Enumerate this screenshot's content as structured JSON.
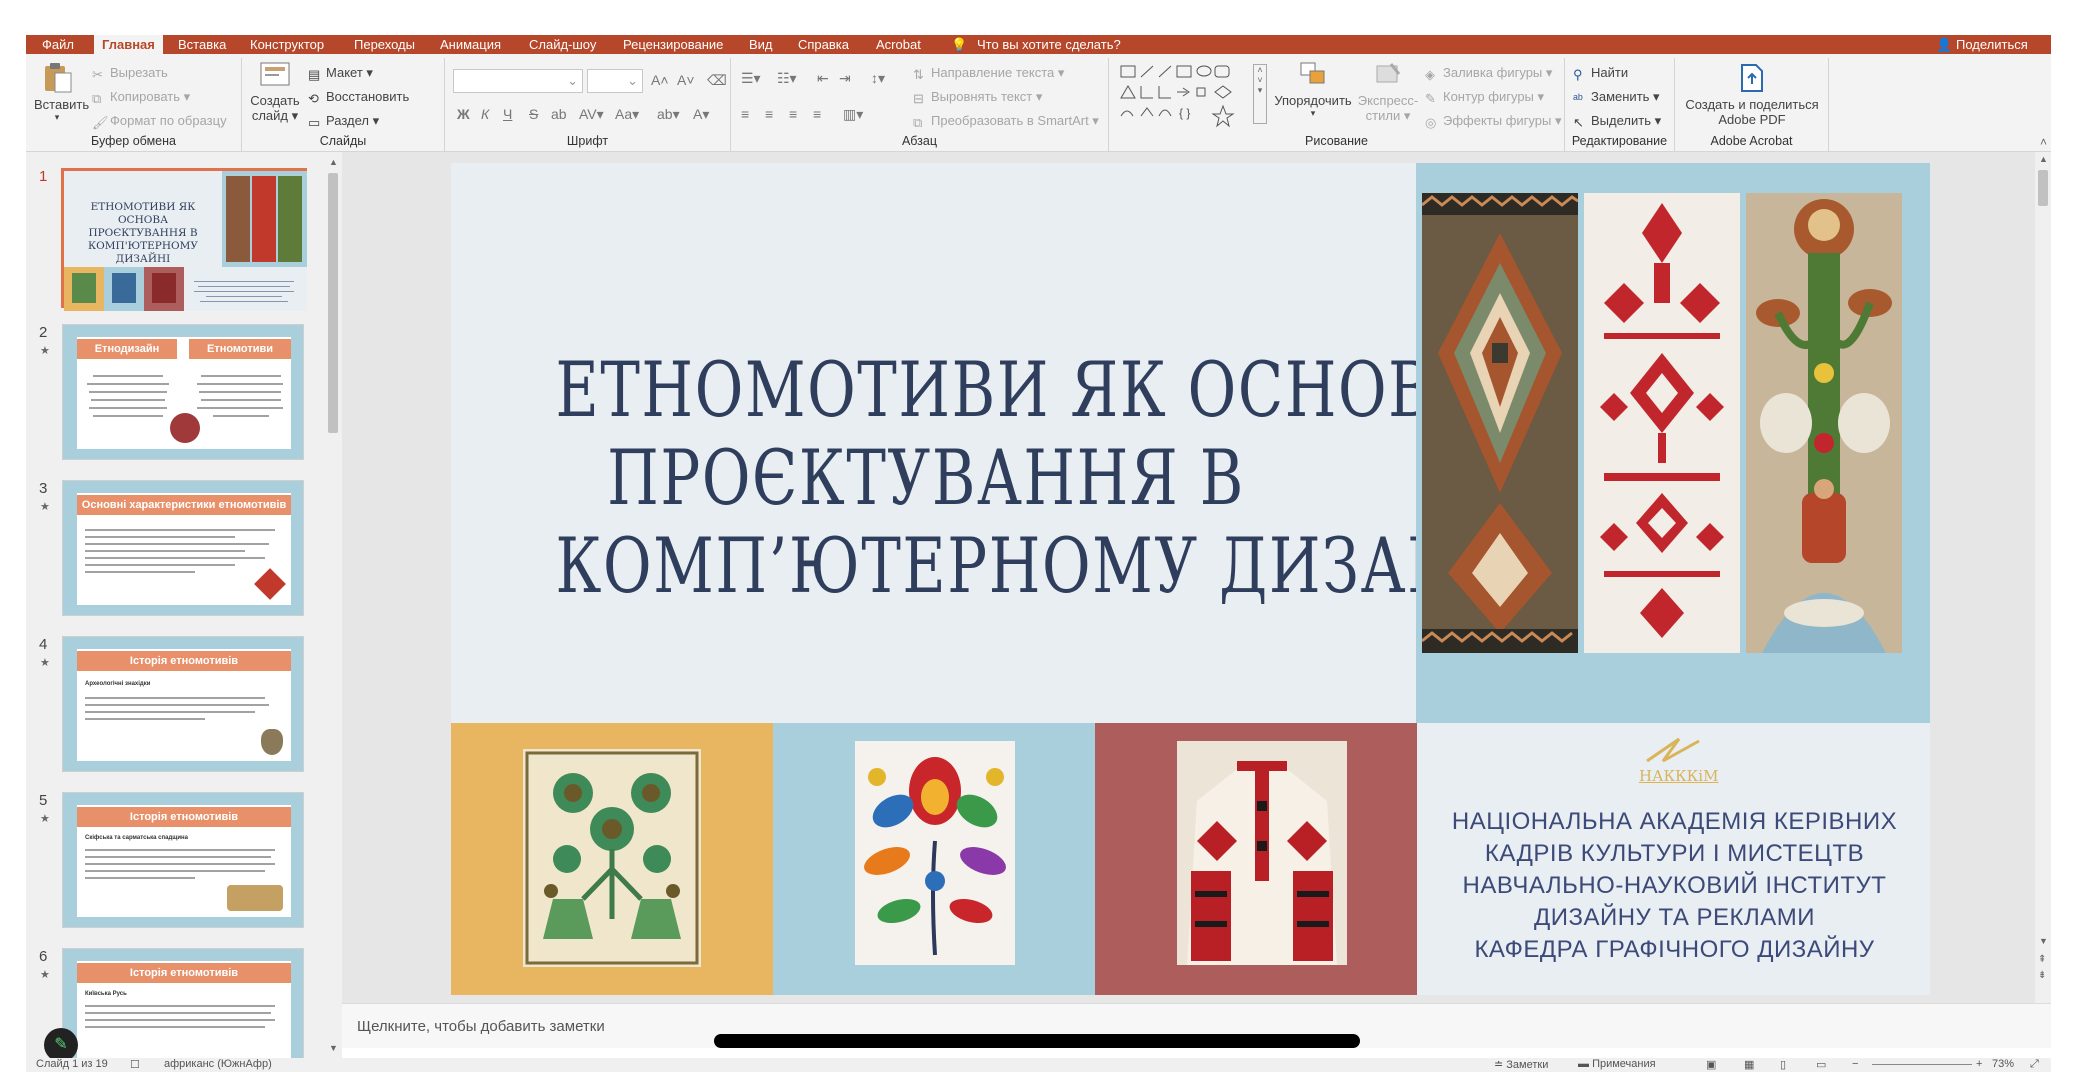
{
  "ribbon_tabs": {
    "file": "Файл",
    "home": "Главная",
    "insert": "Вставка",
    "design": "Конструктор",
    "transitions": "Переходы",
    "animations": "Анимация",
    "slideshow": "Слайд-шоу",
    "review": "Рецензирование",
    "view": "Вид",
    "help": "Справка",
    "acrobat": "Acrobat",
    "tell_me": "Что вы хотите сделать?",
    "share": "Поделиться"
  },
  "clipboard": {
    "paste": "Вставить",
    "cut": "Вырезать",
    "copy": "Копировать",
    "format_painter": "Формат по образцу",
    "label": "Буфер обмена"
  },
  "slides_group": {
    "new_slide_1": "Создать",
    "new_slide_2": "слайд",
    "layout": "Макет",
    "reset": "Восстановить",
    "section": "Раздел",
    "label": "Слайды"
  },
  "font_group": {
    "label": "Шрифт",
    "bold": "Ж",
    "italic": "К",
    "underline": "Ч",
    "strike": "S",
    "case": "Aa"
  },
  "paragraph_group": {
    "text_direction": "Направление текста",
    "align_text": "Выровнять текст",
    "smartart": "Преобразовать в SmartArt",
    "label": "Абзац"
  },
  "drawing_group": {
    "arrange": "Упорядочить",
    "quick_styles_1": "Экспресс-",
    "quick_styles_2": "стили",
    "shape_fill": "Заливка фигуры",
    "shape_outline": "Контур фигуры",
    "shape_effects": "Эффекты фигуры",
    "label": "Рисование"
  },
  "editing_group": {
    "find": "Найти",
    "replace": "Заменить",
    "select": "Выделить",
    "label": "Редактирование"
  },
  "acrobat_group": {
    "create_share_1": "Создать и поделиться",
    "create_share_2": "Adobe PDF",
    "label": "Adobe Acrobat"
  },
  "thumbnails": [
    {
      "num": "1",
      "title": "ЕТНОМОТИВИ ЯК ОСНОВА ПРОЄКТУВАННЯ В КОМП'ЮТЕРНОМУ ДИЗАЙНІ"
    },
    {
      "num": "2",
      "star": "★",
      "col1": "Етнодизайн",
      "col2": "Етномотиви"
    },
    {
      "num": "3",
      "star": "★",
      "title": "Основні характеристики етномотивів"
    },
    {
      "num": "4",
      "star": "★",
      "title": "Історія етномотивів",
      "subtitle": "Археологічні знахідки"
    },
    {
      "num": "5",
      "star": "★",
      "title": "Історія етномотивів",
      "subtitle": "Скіфська та сарматська спадщина"
    },
    {
      "num": "6",
      "star": "★",
      "title": "Історія етномотивів",
      "subtitle": "Київська Русь"
    }
  ],
  "slide": {
    "title_lines": [
      "ЕТНОМОТИВИ ЯК ОСНОВА",
      "ПРОЄКТУВАННЯ В",
      "КОМП’ЮТЕРНОМУ ДИЗАЙНІ"
    ],
    "logo_text": "НАКККіМ",
    "institution_lines": [
      "НАЦІОНАЛЬНА АКАДЕМІЯ КЕРІВНИХ",
      "КАДРІВ КУЛЬТУРИ І МИСТЕЦТВ",
      "НАВЧАЛЬНО-НАУКОВИЙ ІНСТИТУТ",
      "ДИЗАЙНУ ТА РЕКЛАМИ",
      "КАФЕДРА ГРАФІЧНОГО ДИЗАЙНУ"
    ],
    "colors": {
      "background": "#e8eef2",
      "title": "#2f3e5c",
      "panel_blue": "#a9cfdc",
      "panel_yellow": "#e8b560",
      "panel_red": "#ad5e5c"
    }
  },
  "notes_placeholder": "Щелкните, чтобы добавить заметки",
  "status_bar": {
    "slide_count": "Слайд 1 из 19",
    "language": "африканс (ЮжнАфр)",
    "notes": "Заметки",
    "comments": "Примечания",
    "zoom": "73%"
  },
  "accent_color": "#b7472a"
}
